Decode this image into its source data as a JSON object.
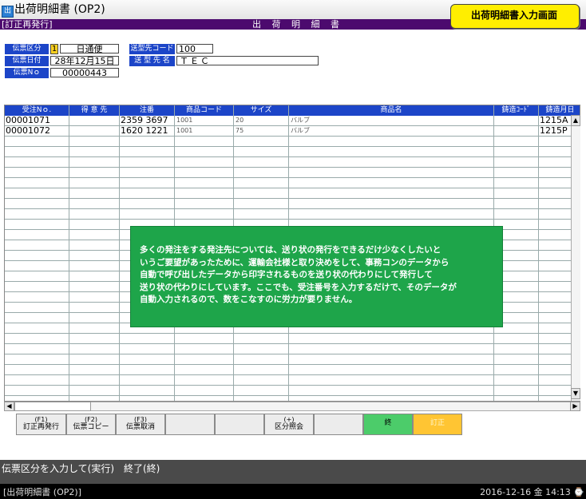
{
  "window": {
    "icon": "app-icon",
    "title": "出荷明細書 (OP2)"
  },
  "header": {
    "mode": "[訂正再発行]",
    "form_title": "出 荷 明 細 書"
  },
  "screen_badge": "出荷明細書入力画面",
  "fields": {
    "slip_type": {
      "label": "伝票区分",
      "code": "1",
      "value": "日通便"
    },
    "slip_date": {
      "label": "伝票日付",
      "value": "28年12月15日"
    },
    "slip_no": {
      "label": "伝票Nｏ",
      "value": "00000443"
    },
    "dest_code": {
      "label": "送型先コード",
      "value": "100"
    },
    "dest_name": {
      "label": "送 型 先 名",
      "value": "ＴＥＣ"
    }
  },
  "grid": {
    "columns": [
      "受注Nｏ.",
      "得 意 先",
      "注番",
      "商品コード",
      "サイズ",
      "商品名",
      "鋳造ｺｰﾄﾞ",
      "鋳造月日"
    ],
    "rows": [
      {
        "order_no": "00001071",
        "customer": "",
        "po_no": "2359 3697",
        "product_code": "1001",
        "size": "20",
        "product_name": "バルブ",
        "cast_code": "",
        "cast_date": "1215A"
      },
      {
        "order_no": "00001072",
        "customer": "",
        "po_no": "1620 1221",
        "product_code": "1001",
        "size": "75",
        "product_name": "バルブ",
        "cast_code": "",
        "cast_date": "1215P"
      }
    ],
    "empty_rows": 26
  },
  "overlay": {
    "color": "#1ea54a",
    "lines": [
      "多くの発注をする発注先については、送り状の発行をできるだけ少なくしたいと",
      "いうご要望があったために、運輸会社様と取り決めをして、事務コンのデータから",
      "自動で呼び出したデータから印字されるものを送り状の代わりにして発行して",
      "送り状の代わりにしています。ここでも、受注番号を入力するだけで、そのデータが",
      "自動入力されるので、数をこなすのに労力が要りません。"
    ]
  },
  "function_keys": [
    {
      "key": "(F1)",
      "label": "訂正再発行"
    },
    {
      "key": "(F2)",
      "label": "伝票コピー"
    },
    {
      "key": "(F3)",
      "label": "伝票取消"
    },
    {
      "key": "",
      "label": ""
    },
    {
      "key": "",
      "label": ""
    },
    {
      "key": "(+)",
      "label": "区分照会"
    },
    {
      "key": "",
      "label": ""
    },
    {
      "key": "",
      "label": "終"
    },
    {
      "key": "",
      "label": "訂正"
    }
  ],
  "colors": {
    "accent_purple": "#4c0a6e",
    "label_blue": "#1c45c8",
    "key_green": "#4ccc6a",
    "key_orange": "#ffc533",
    "badge_yellow": "#ffee00"
  },
  "status": {
    "message": "伝票区分を入力して(実行)　終了(終)"
  },
  "taskbar": {
    "left": "[出荷明細書 (OP2)]",
    "right": "2016-12-16 金 14:13 ⌚"
  }
}
